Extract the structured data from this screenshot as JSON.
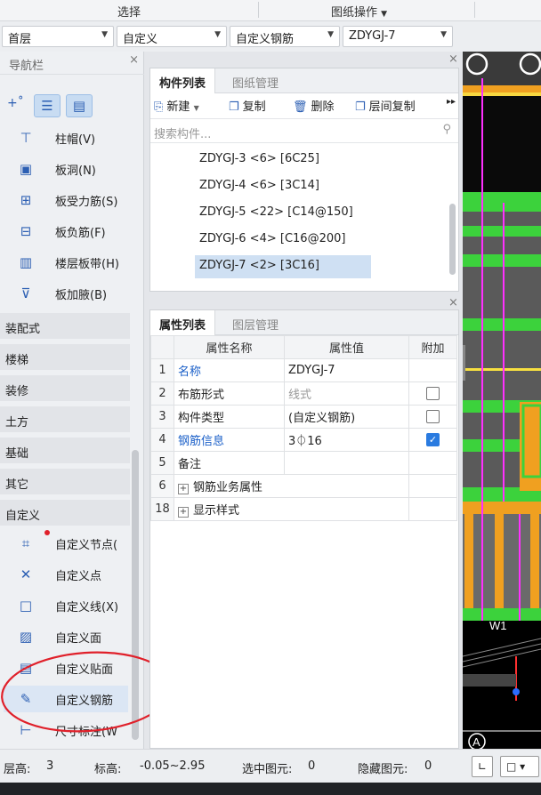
{
  "topbar": {
    "select_label": "选择",
    "drawing_ops_label": "图纸操作"
  },
  "selectors": {
    "floor": "首层",
    "category": "自定义",
    "type": "自定义钢筋",
    "item": "ZDYGJ-7"
  },
  "nav": {
    "title": "导航栏",
    "items_top": [
      {
        "label": "柱帽(V)",
        "icon": "column-cap-icon",
        "glyph": "⊤"
      },
      {
        "label": "板洞(N)",
        "icon": "slab-hole-icon",
        "glyph": "▣"
      },
      {
        "label": "板受力筋(S)",
        "icon": "slab-rebar-icon",
        "glyph": "⊞"
      },
      {
        "label": "板负筋(F)",
        "icon": "slab-neg-rebar-icon",
        "glyph": "⊟"
      },
      {
        "label": "楼层板带(H)",
        "icon": "floor-band-icon",
        "glyph": "▥"
      },
      {
        "label": "板加腋(B)",
        "icon": "slab-haunch-icon",
        "glyph": "⊽"
      }
    ],
    "categories": [
      "装配式",
      "楼梯",
      "装修",
      "土方",
      "基础",
      "其它",
      "自定义"
    ],
    "items_custom": [
      {
        "label": "自定义节点(",
        "icon": "custom-node-icon",
        "glyph": "⌗"
      },
      {
        "label": "自定义点",
        "icon": "custom-point-icon",
        "glyph": "✕"
      },
      {
        "label": "自定义线(X)",
        "icon": "custom-line-icon",
        "glyph": "□"
      },
      {
        "label": "自定义面",
        "icon": "custom-face-icon",
        "glyph": "▨"
      },
      {
        "label": "自定义贴面",
        "icon": "custom-veneer-icon",
        "glyph": "▤"
      },
      {
        "label": "自定义钢筋",
        "icon": "custom-rebar-icon",
        "glyph": "✎"
      },
      {
        "label": "尺寸标注(W",
        "icon": "dimension-icon",
        "glyph": "⊢"
      }
    ]
  },
  "component_panel": {
    "tabs": [
      "构件列表",
      "图纸管理"
    ],
    "toolbar": {
      "new": "新建",
      "copy": "复制",
      "delete": "删除",
      "floor_copy": "层间复制"
    },
    "search_placeholder": "搜索构件...",
    "items": [
      "ZDYGJ-3 <6> [6C25]",
      "ZDYGJ-4 <6> [3C14]",
      "ZDYGJ-5 <22> [C14@150]",
      "ZDYGJ-6 <4> [C16@200]",
      "ZDYGJ-7 <2> [3C16]"
    ]
  },
  "property_panel": {
    "tabs": [
      "属性列表",
      "图层管理"
    ],
    "headers": {
      "name": "属性名称",
      "value": "属性值",
      "extra": "附加"
    },
    "rows": [
      {
        "num": "1",
        "name": "名称",
        "value": "ZDYGJ-7",
        "check": "none"
      },
      {
        "num": "2",
        "name": "布筋形式",
        "value": "线式",
        "check": "off"
      },
      {
        "num": "3",
        "name": "构件类型",
        "value": "(自定义钢筋)",
        "check": "off"
      },
      {
        "num": "4",
        "name": "钢筋信息",
        "value": "3⏀16",
        "check": "on"
      },
      {
        "num": "5",
        "name": "备注",
        "value": "",
        "check": "none"
      },
      {
        "num": "6",
        "name": "钢筋业务属性",
        "value": "",
        "check": "none"
      },
      {
        "num": "18",
        "name": "显示样式",
        "value": "",
        "check": "none"
      }
    ]
  },
  "canvas": {
    "label_w1": "W1",
    "label_a": "A"
  },
  "status": {
    "floor_height_label": "层高:",
    "floor_height": "3",
    "elevation_label": "标高:",
    "elevation": "-0.05~2.95",
    "selected_label": "选中图元:",
    "selected": "0",
    "hidden_label": "隐藏图元:",
    "hidden": "0"
  },
  "colors": {
    "accent": "#2c5fb3",
    "selection": "#cfe0f3",
    "annotation_red": "#e0202a"
  }
}
